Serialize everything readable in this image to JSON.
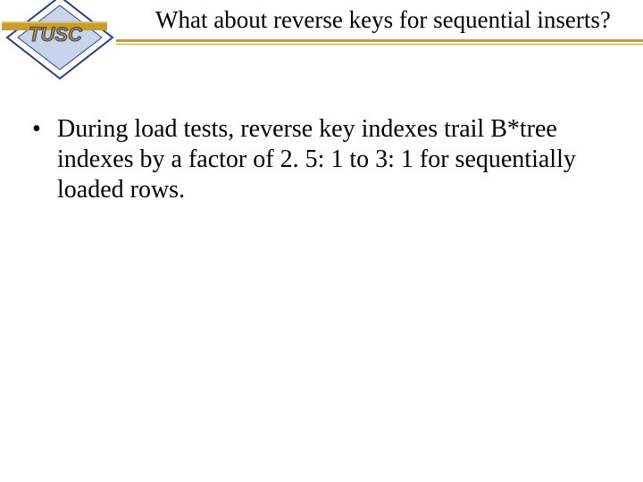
{
  "logo": {
    "text": "TUSC",
    "colors": {
      "diamond_fill": "#ffffff",
      "diamond_stroke": "#2d3e7a",
      "inner_fill": "#8fa7d6",
      "gold": "#c79e2d",
      "text_fill": "#b78f20",
      "text_stroke": "#2d3e7a"
    }
  },
  "title": "What about reverse keys for sequential inserts?",
  "bullets": [
    "During load tests, reverse key indexes trail B*tree indexes by a factor of 2. 5: 1 to 3: 1 for sequentially loaded rows."
  ]
}
